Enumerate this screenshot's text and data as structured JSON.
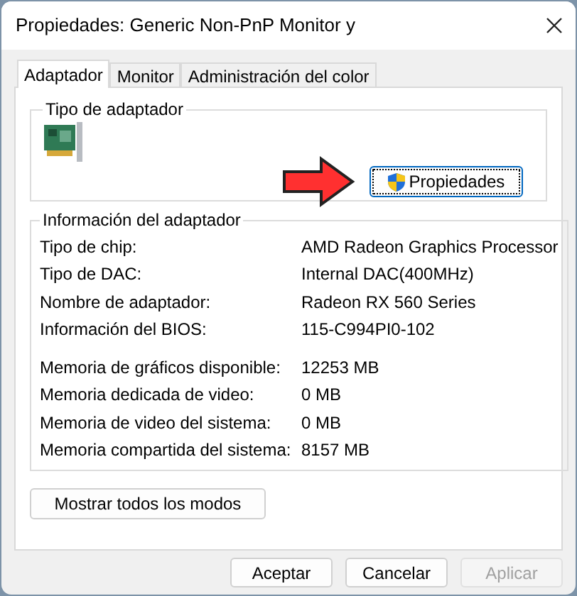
{
  "window": {
    "title": "Propiedades: Generic Non-PnP Monitor y"
  },
  "tabs": [
    {
      "label": "Adaptador",
      "selected": true
    },
    {
      "label": "Monitor",
      "selected": false
    },
    {
      "label": "Administración del color",
      "selected": false
    }
  ],
  "adapter_type": {
    "title": "Tipo de adaptador",
    "button": "Propiedades"
  },
  "adapter_info": {
    "title": "Información del adaptador",
    "groups": [
      [
        {
          "label": "Tipo de chip:",
          "value": "AMD Radeon Graphics Processor"
        },
        {
          "label": "Tipo de DAC:",
          "value": "Internal DAC(400MHz)"
        },
        {
          "label": "Nombre de adaptador:",
          "value": "Radeon RX 560 Series"
        },
        {
          "label": "Información del BIOS:",
          "value": "115-C994PI0-102"
        }
      ],
      [
        {
          "label": "Memoria de gráficos disponible:",
          "value": "12253 MB"
        },
        {
          "label": "Memoria dedicada de video:",
          "value": "0 MB"
        },
        {
          "label": "Memoria de video del sistema:",
          "value": "0 MB"
        },
        {
          "label": "Memoria compartida del sistema:",
          "value": "8157 MB"
        }
      ]
    ]
  },
  "list_modes_button": "Mostrar todos los modos",
  "buttons": [
    {
      "label": "Aceptar",
      "disabled": false
    },
    {
      "label": "Cancelar",
      "disabled": false
    },
    {
      "label": "Aplicar",
      "disabled": true
    }
  ]
}
